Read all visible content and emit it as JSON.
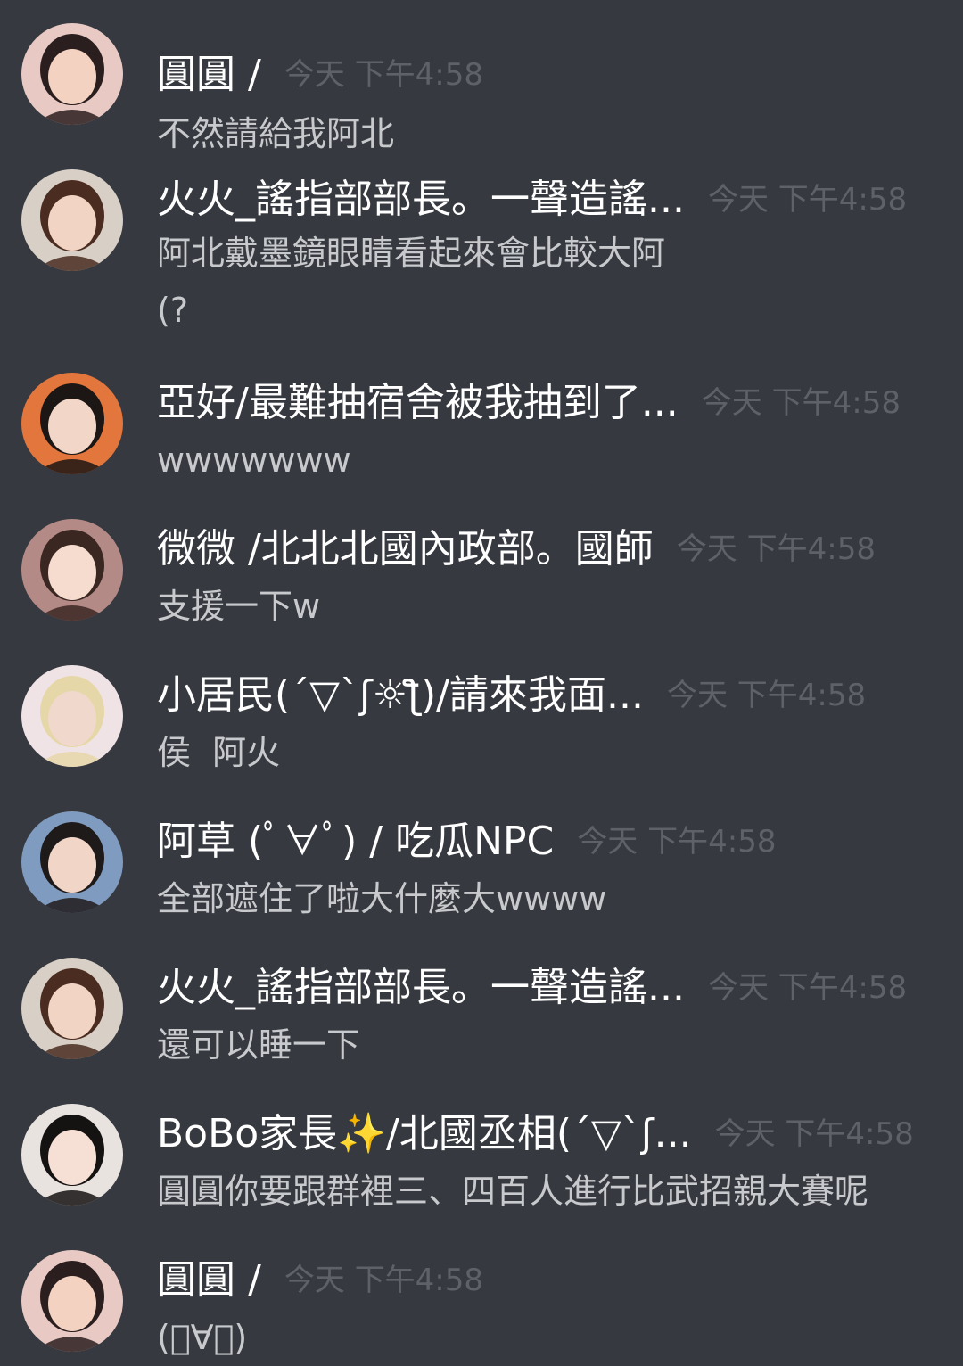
{
  "messages": [
    {
      "username": "圓圓 /",
      "timestamp": "今天 下午4:58",
      "content": "不然請給我阿北",
      "avatar": {
        "name": "avatar-yuanyuan",
        "bg": "#e8c9c4",
        "face": "#f3d2c1",
        "hair": "#2a1e1e"
      }
    },
    {
      "username": "火火_謠指部部長。一聲造謠...",
      "timestamp": "今天 下午4:58",
      "content": "阿北戴墨鏡眼睛看起來會比較大阿\n(?",
      "avatar": {
        "name": "avatar-huohuo",
        "bg": "#d8cfc6",
        "face": "#f1d4c3",
        "hair": "#4a2d20"
      }
    },
    {
      "username": "亞好/最難抽宿舍被我抽到了...",
      "timestamp": "今天 下午4:58",
      "content": "wwwwwww",
      "avatar": {
        "name": "avatar-yahao",
        "bg": "#e2763c",
        "face": "#f2d7c9",
        "hair": "#1c1614"
      }
    },
    {
      "username": "微微 /北北北國內政部。國師",
      "timestamp": "今天 下午4:58",
      "content": "支援一下w",
      "avatar": {
        "name": "avatar-weiwei",
        "bg": "#b48a86",
        "face": "#f5dccf",
        "hair": "#3b2722"
      }
    },
    {
      "username": "小居民(´▽`ʃ☼ƪ)/請來我面...",
      "timestamp": "今天 下午4:58",
      "content": "侯  阿火",
      "avatar": {
        "name": "avatar-xiaojumin",
        "bg": "#efe3e6",
        "face": "#f0d8cc",
        "hair": "#e6d7a8"
      }
    },
    {
      "username": "阿草 (ﾟ∀ﾟ) / 吃瓜NPC",
      "timestamp": "今天 下午4:58",
      "content": "全部遮住了啦大什麼大wwww",
      "avatar": {
        "name": "avatar-acao",
        "bg": "#7f9bbf",
        "face": "#f1d6c8",
        "hair": "#1e1a1a"
      }
    },
    {
      "username": "火火_謠指部部長。一聲造謠...",
      "timestamp": "今天 下午4:58",
      "content": "還可以睡一下",
      "avatar": {
        "name": "avatar-huohuo-2",
        "bg": "#d8cfc6",
        "face": "#f1d4c3",
        "hair": "#4a2d20"
      }
    },
    {
      "username": "BoBo家長✨/北國丞相(´▽`ʃ...",
      "timestamp": "今天 下午4:58",
      "content": "圓圓你要跟群裡三、四百人進行比武招親大賽呢",
      "avatar": {
        "name": "avatar-bobo",
        "bg": "#e9e3e0",
        "face": "#f6dfd4",
        "hair": "#151212"
      }
    },
    {
      "username": "圓圓 /",
      "timestamp": "今天 下午4:58",
      "content": "(ﾟ∀ﾟ)",
      "avatar": {
        "name": "avatar-yuanyuan-2",
        "bg": "#e8c9c4",
        "face": "#f3d2c1",
        "hair": "#2a1e1e"
      }
    }
  ]
}
